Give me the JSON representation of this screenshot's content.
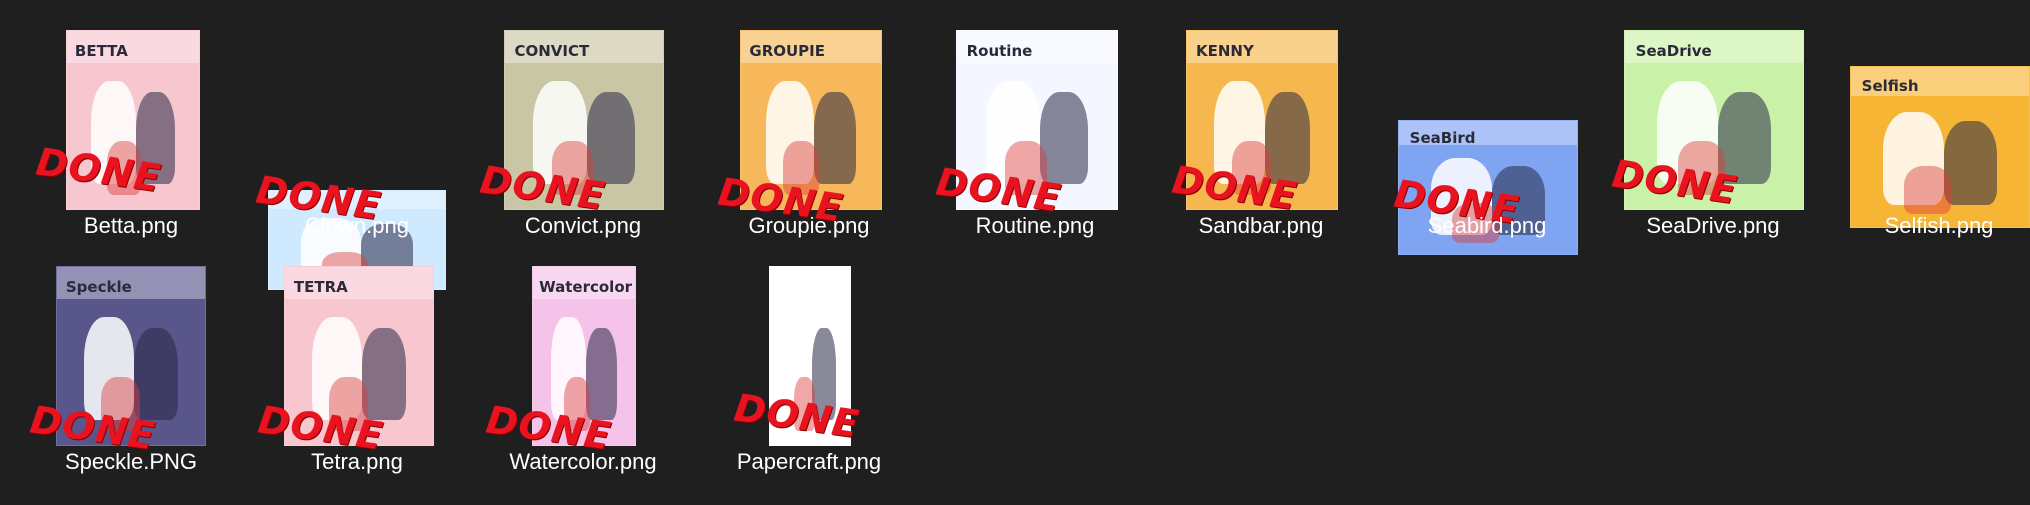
{
  "files": [
    {
      "name": "Betta.png",
      "title": "BETTA",
      "bg": "#f7c7cf",
      "status": "DONE"
    },
    {
      "name": "Clown.png",
      "title": "",
      "bg": "#cfe9ff",
      "status": "DONE"
    },
    {
      "name": "Convict.png",
      "title": "CONVICT",
      "bg": "#c9c6a6",
      "status": "DONE"
    },
    {
      "name": "Groupie.png",
      "title": "GROUPIE",
      "bg": "#f6b85a",
      "status": "DONE"
    },
    {
      "name": "Routine.png",
      "title": "Routine",
      "bg": "#f4f7ff",
      "status": "DONE"
    },
    {
      "name": "Sandbar.png",
      "title": "KENNY",
      "bg": "#f6b84e",
      "status": "DONE"
    },
    {
      "name": "Seabird.png",
      "title": "SeaBird",
      "bg": "#7ea4f2",
      "status": "DONE"
    },
    {
      "name": "SeaDrive.png",
      "title": "SeaDrive",
      "bg": "#c9f1a8",
      "status": "DONE"
    },
    {
      "name": "Selfish.png",
      "title": "Selfish",
      "bg": "#f6b535",
      "status": ""
    },
    {
      "name": "Speckle.PNG",
      "title": "Speckle",
      "bg": "#59568c",
      "status": "DONE"
    },
    {
      "name": "Tetra.png",
      "title": "TETRA",
      "bg": "#f7c6cf",
      "status": "DONE"
    },
    {
      "name": "Watercolor.png",
      "title": "Watercolor",
      "bg": "#f5c2e9",
      "status": "DONE"
    },
    {
      "name": "Papercraft.png",
      "title": "",
      "bg": "#ffffff",
      "status": "DONE"
    }
  ]
}
